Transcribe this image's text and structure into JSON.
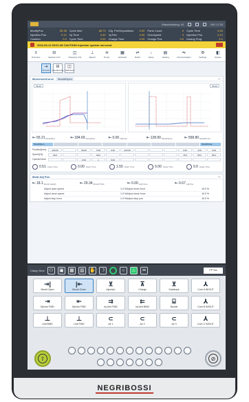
{
  "status_bar": {
    "left_title": "",
    "mid_text": "Manufacturing: 00",
    "clock": "MO  17:33"
  },
  "info": {
    "col1": [
      {
        "k": "ModifyPos",
        "v": "55.38"
      },
      {
        "k": "Injection Pos",
        "v": "0.12"
      },
      {
        "k": "Cushion",
        "v": "0.0"
      }
    ],
    "col2": [
      {
        "k": "Cycle time",
        "v": "88.73"
      },
      {
        "k": "Inj Time",
        "v": "0.00"
      },
      {
        "k": "Cycle Time",
        "v": "0.00"
      }
    ],
    "col3": [
      {
        "k": "Cfg. Pre/Depositions",
        "v": "0.00"
      },
      {
        "k": "Inj Rec",
        "v": "0.00"
      },
      {
        "k": "Charge Time",
        "v": "0.00"
      }
    ],
    "col4": [
      {
        "k": "Parts Count",
        "v": "0"
      },
      {
        "k": "Checkpoint",
        "v": "0"
      },
      {
        "k": "Charge Pos",
        "v": "0.0"
      }
    ],
    "col5": [
      {
        "k": "Cycle Time",
        "v": "0.00"
      },
      {
        "k": "Injection Pos",
        "v": "0.12"
      },
      {
        "k": "Dosing Prog",
        "v": "0.1"
      }
    ]
  },
  "alarm": {
    "text": "2016-06-11 09:01:28   CAUTION! Injection system not used",
    "count": "1"
  },
  "nav": [
    {
      "icon": "≡",
      "label": "Overview"
    },
    {
      "icon": "⊟",
      "label": "Injection Unit"
    },
    {
      "icon": "◫",
      "label": "Clamping Unit"
    },
    {
      "icon": "⊥",
      "label": "Ejector"
    },
    {
      "icon": "≋",
      "label": "Tempr."
    },
    {
      "icon": "▦",
      "label": "Hydraulic"
    },
    {
      "icon": "⇌",
      "label": "Robot"
    },
    {
      "icon": "↓",
      "label": "Setup"
    },
    {
      "icon": "▤",
      "label": "Heating"
    },
    {
      "icon": "⇋",
      "label": "Documentation"
    },
    {
      "icon": "⚙",
      "label": "Settings"
    },
    {
      "icon": "◧",
      "label": "System"
    }
  ],
  "subtabs": [
    {
      "icon": "⇥",
      "label": "Process",
      "active": true
    },
    {
      "icon": "⊟",
      "label": "Conditioning"
    },
    {
      "icon": "◫",
      "label": "Calibration"
    }
  ],
  "movement": {
    "title": "MovementCurve",
    "tag": "MouldOpen",
    "left_val": "55.25",
    "right_val": "55.25",
    "right_tag": "MouldClose"
  },
  "values": [
    {
      "n": "55.21",
      "u": "MouldPos"
    },
    {
      "n": "184.69",
      "u": "ScrewPos"
    },
    {
      "n": "0.00",
      "u": "InjPress"
    },
    {
      "n": "128.90",
      "u": "MouldTemp"
    },
    {
      "n": "558.80",
      "u": "MouldForce"
    }
  ],
  "profile": {
    "left_label": "MouldOpen",
    "right_label": "MouldClose",
    "rows": [
      {
        "h": "Position[mm]",
        "cells": [
          "220.00",
          "",
          "50.00",
          "5.00",
          "0.00",
          "220.00",
          "",
          "",
          "",
          "0.00",
          "4.00",
          "0.00"
        ]
      },
      {
        "h": "Speed[%]",
        "cells": [
          "99.0",
          "",
          "",
          "99.0",
          "",
          "",
          "",
          "",
          "",
          "75.0",
          "55.0",
          "85.0"
        ]
      },
      {
        "h": "Opened time",
        "cells": [
          "",
          "",
          "0.00",
          "s",
          "9.00",
          "",
          "",
          "",
          "",
          "",
          "",
          ""
        ]
      }
    ]
  },
  "gauges": [
    {
      "n": "0.51",
      "u": "Close Time"
    },
    {
      "n": "0.00",
      "u": "Open Time"
    },
    {
      "n": "1.55",
      "u": "Open Time"
    },
    {
      "n": "0.00",
      "u": "Close Time"
    },
    {
      "n": "0.0",
      "u": "Delay Time"
    }
  ],
  "mold_adj": {
    "title": "Mold Adj Pos",
    "vals": [
      {
        "n": "18.1",
        "u": "Mould Height"
      },
      {
        "n": "29.34",
        "u": "Mould Thick"
      },
      {
        "n": "0.00",
        "u": "Adj Force"
      },
      {
        "n": "0.67",
        "u": "Adj Pos"
      }
    ],
    "rows": [
      {
        "k": "Adjust open speed",
        "v": "1.0  %",
        "k2": "Adjust force force",
        "v2": "10.0  %"
      },
      {
        "k": "Adjust close speed",
        "v": "1.0  %",
        "k2": "Adjust close force",
        "v2": "10.0  %"
      },
      {
        "k": "Adjust stop force",
        "v": "1.0  %",
        "k2": "Adjust stop pos",
        "v2": "10.0  %"
      }
    ]
  },
  "keypad": {
    "label": "Clamp Serv",
    "select": "PP Yes",
    "keys": [
      {
        "g": "⇥|",
        "l": "Mould Open"
      },
      {
        "g": "|⇤",
        "l": "Mould Close",
        "active": true
      },
      {
        "g": "⊻",
        "l": "Injection"
      },
      {
        "g": "⊼",
        "l": "Charge"
      },
      {
        "g": "⊻",
        "l": "Suckback"
      },
      {
        "g": "⅄",
        "l": "Core A IN/OUT"
      },
      {
        "g": "⇥",
        "l": "Ejector FWD"
      },
      {
        "g": "⇤",
        "l": "Ejector FWD"
      },
      {
        "g": "⇉",
        "l": "Inj.Unit FWD"
      },
      {
        "g": "⇇",
        "l": "Inj.Unit BWD"
      },
      {
        "g": "⌸",
        "l": "Nozzle"
      },
      {
        "g": "⅄",
        "l": "Core B IN/OUT"
      },
      {
        "g": "⊥",
        "l": "Unit BWD"
      },
      {
        "g": "⊥",
        "l": "Unit FWD"
      },
      {
        "g": "⊂",
        "l": "Air 1"
      },
      {
        "g": "⊂",
        "l": "Air 2"
      },
      {
        "g": "⊂",
        "l": "Air 3"
      },
      {
        "g": "⅄",
        "l": "Core C IN/OUT"
      }
    ]
  },
  "brand": "NEGRIBOSSI",
  "colors": {
    "accent": "#3b83c4",
    "alarm": "#f2d33a",
    "go": "#b8cf3a",
    "frame": "#2b2f33"
  }
}
